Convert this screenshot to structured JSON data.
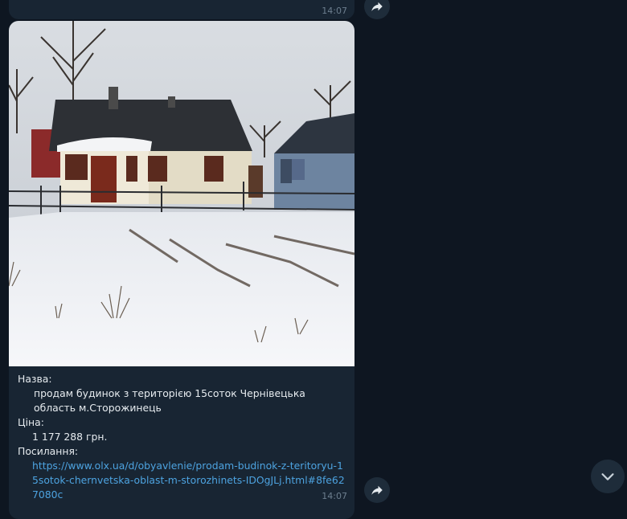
{
  "previous_message": {
    "time": "14:07"
  },
  "message": {
    "name_label": "Назва:",
    "name_value": "продам будинок з територією 15соток Чернівецька область м.Сторожинець",
    "price_label": "Ціна:",
    "price_value": "1 177 288 грн.",
    "link_label": "Посилання:",
    "link_url": "https://www.olx.ua/d/obyavlenie/prodam-budinok-z-teritoryu-15sotok-chernvetska-oblast-m-storozhinets-IDOgJLj.html#8fe627080c",
    "time": "14:07"
  },
  "icons": {
    "forward": "share-arrow-icon",
    "scroll_down": "chevron-down-icon"
  },
  "colors": {
    "background": "#0e1621",
    "bubble": "#182533",
    "link": "#4da3e0",
    "time": "#6d7f8f"
  }
}
